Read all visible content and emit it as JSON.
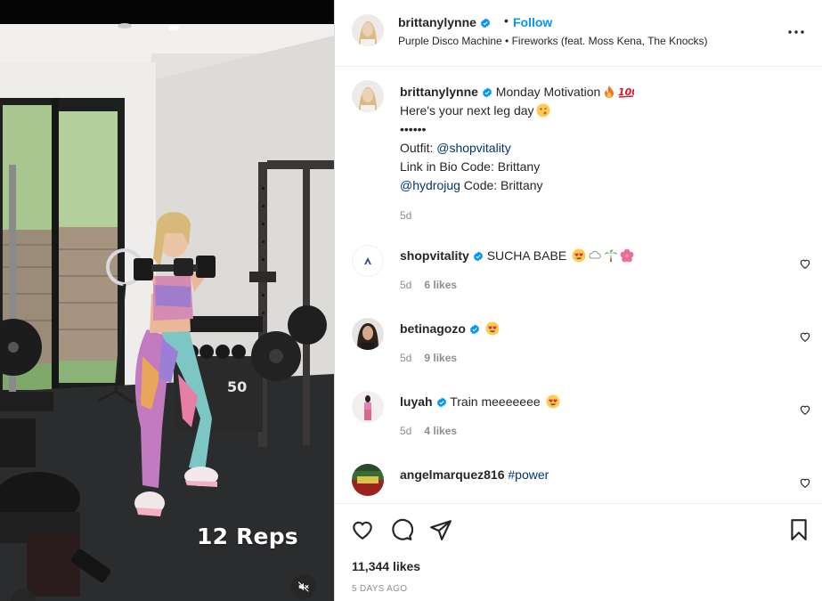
{
  "media": {
    "overlay_text": "12 Reps",
    "audio_icon": "muted-speaker-icon"
  },
  "header": {
    "username": "brittanylynne",
    "separator": "•",
    "follow_label": "Follow",
    "audio_info": "Purple Disco Machine • Fireworks (feat. Moss Kena, The Knocks)",
    "more_icon": "more-options-icon"
  },
  "caption": {
    "username": "brittanylynne",
    "line1": "Monday Motivation",
    "line1_emojis": [
      "fire",
      "hundred-points"
    ],
    "line2": "Here's your next leg day",
    "line2_emoji": "kissing-face",
    "line3": "••••••",
    "line4_prefix": "Outfit: ",
    "line4_mention": "@shopvitality",
    "line5": "Link in Bio Code: Brittany",
    "line6_mention": "@hydrojug",
    "line6_suffix": " Code: Brittany",
    "time": "5d"
  },
  "comments": [
    {
      "username": "shopvitality",
      "verified": true,
      "text": "SUCHA BABE",
      "emojis": [
        "heart-eyes",
        "cloud",
        "palm-tree",
        "hibiscus"
      ],
      "time": "5d",
      "likes": "6 likes"
    },
    {
      "username": "betinagozo",
      "verified": true,
      "text": "",
      "emojis": [
        "heart-eyes"
      ],
      "time": "5d",
      "likes": "9 likes"
    },
    {
      "username": "luyah",
      "verified": true,
      "text": "Train meeeeeee",
      "emojis": [
        "heart-eyes"
      ],
      "time": "5d",
      "likes": "4 likes"
    },
    {
      "username": "angelmarquez816",
      "verified": false,
      "text": "",
      "hashtag": "#power",
      "emojis": [],
      "time": "",
      "likes": ""
    }
  ],
  "actions": {
    "likes": "11,344 likes",
    "date": "5 DAYS AGO"
  },
  "colors": {
    "link": "#0095f6",
    "mention": "#00376b",
    "verified": "#0095f6",
    "secondary": "#8e8e8e"
  }
}
